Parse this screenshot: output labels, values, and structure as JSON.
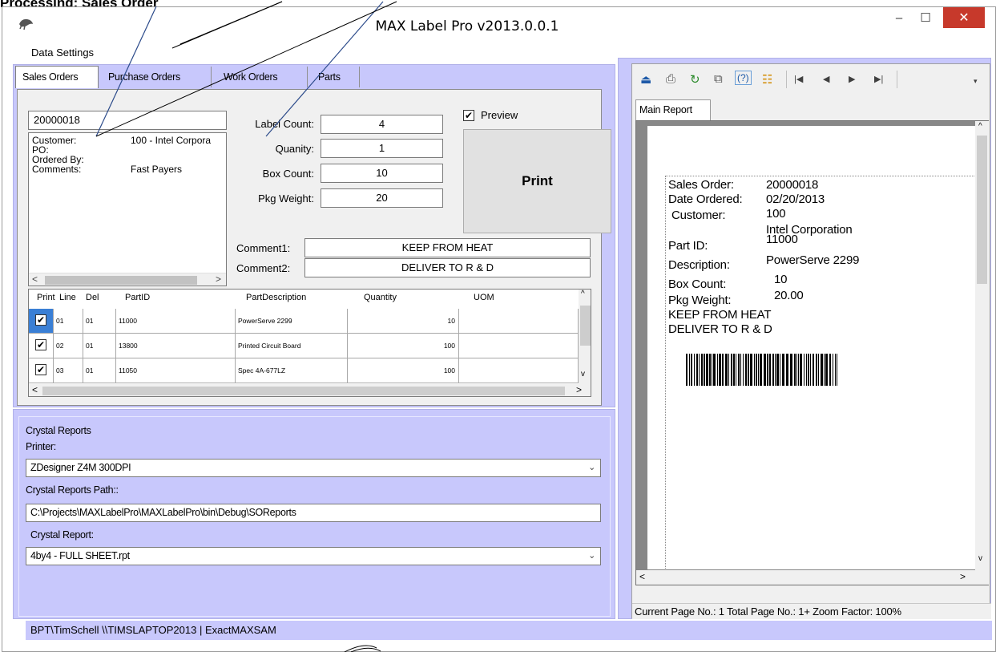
{
  "annotation": {
    "title": "Processing: Sales Order"
  },
  "window": {
    "title": "MAX Label Pro v2013.0.0.1",
    "min_glyph": "–",
    "max_glyph": "☐",
    "close_glyph": "✕"
  },
  "menu": {
    "data_settings": "Data Settings"
  },
  "tabs": [
    "Sales Orders",
    "Purchase Orders",
    "Work Orders",
    "Parts"
  ],
  "sales": {
    "order_number": "20000018",
    "info": {
      "customer_label": "Customer:",
      "customer_value": "100 - Intel Corpora",
      "po_label": "PO:",
      "po_value": "",
      "ordered_by_label": "Ordered By:",
      "ordered_by_value": "",
      "comments_label": "Comments:",
      "comments_value": "Fast Payers"
    },
    "label_count_label": "Label Count:",
    "label_count": "4",
    "quantity_label": "Quanity:",
    "quantity": "1",
    "box_count_label": "Box Count:",
    "box_count": "10",
    "pkg_weight_label": "Pkg Weight:",
    "pkg_weight": "20",
    "preview_label": "Preview",
    "preview_checked": true,
    "print_label": "Print",
    "comment1_label": "Comment1:",
    "comment1": "KEEP FROM HEAT",
    "comment2_label": "Comment2:",
    "comment2": "DELIVER TO R & D"
  },
  "grid": {
    "columns": [
      "Print",
      "Line",
      "Del",
      "PartID",
      "PartDescription",
      "Quantity",
      "UOM"
    ],
    "rows": [
      {
        "print": true,
        "line": "01",
        "del": "01",
        "part_id": "11000",
        "desc": "PowerServe 2299",
        "quantity": "10",
        "uom": ""
      },
      {
        "print": true,
        "line": "02",
        "del": "01",
        "part_id": "13800",
        "desc": "Printed Circuit Board",
        "quantity": "100",
        "uom": ""
      },
      {
        "print": true,
        "line": "03",
        "del": "01",
        "part_id": "11050",
        "desc": "Spec 4A-677LZ",
        "quantity": "100",
        "uom": ""
      }
    ]
  },
  "crystal": {
    "group_title": "Crystal Reports",
    "printer_label": "Printer:",
    "printer": "ZDesigner Z4M 300DPI",
    "path_label": "Crystal Reports Path::",
    "path": "C:\\Projects\\MAXLabelPro\\MAXLabelPro\\bin\\Debug\\SOReports",
    "report_label": "Crystal Report:",
    "report": "4by4 - FULL SHEET.rpt"
  },
  "status": {
    "text": "BPT\\TimSchell  \\\\TIMSLAPTOP2013 | ExactMAXSAM"
  },
  "viewer": {
    "tab": "Main Report",
    "status": "Current Page No.: 1  Total Page No.: 1+  Zoom Factor: 100%",
    "report": {
      "sales_order_label": "Sales Order:",
      "sales_order": "20000018",
      "date_label": "Date Ordered:",
      "date": "02/20/2013",
      "customer_label": "Customer:",
      "customer_id": "100",
      "customer_name": "Intel Corporation",
      "part_label": "Part ID:",
      "part_id": "11000",
      "desc_label": "Description:",
      "desc": "PowerServe 2299",
      "box_label": "Box Count:",
      "box": "10",
      "weight_label": "Pkg Weight:",
      "weight": "20.00",
      "comment1": "KEEP FROM HEAT",
      "comment2": "DELIVER TO R & D"
    }
  }
}
